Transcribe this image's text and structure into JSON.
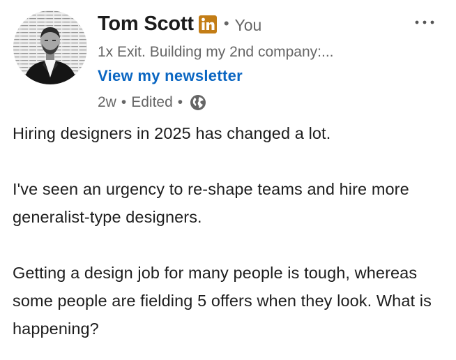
{
  "post": {
    "author": {
      "name": "Tom Scott",
      "badge_icon": "linkedin-premium-icon",
      "badge_color": "#c37d16",
      "separator": "•",
      "degree": "You",
      "headline": "1x Exit. Building my 2nd company:...",
      "newsletter_label": "View my newsletter"
    },
    "meta": {
      "time": "2w",
      "separator": "•",
      "edited": "Edited",
      "separator2": "•",
      "visibility_icon": "globe-icon"
    },
    "more_icon": "ellipsis-icon",
    "paragraphs": [
      "Hiring designers in 2025 has changed a lot.",
      "I've seen an urgency to re-shape teams and hire more generalist-type designers.",
      "Getting a design job for many people is tough, whereas some people are fielding 5 offers when they look. What is happening?"
    ]
  },
  "colors": {
    "link": "#0a66c2",
    "secondary_text": "#666666",
    "primary_text": "#1d1d1d"
  }
}
